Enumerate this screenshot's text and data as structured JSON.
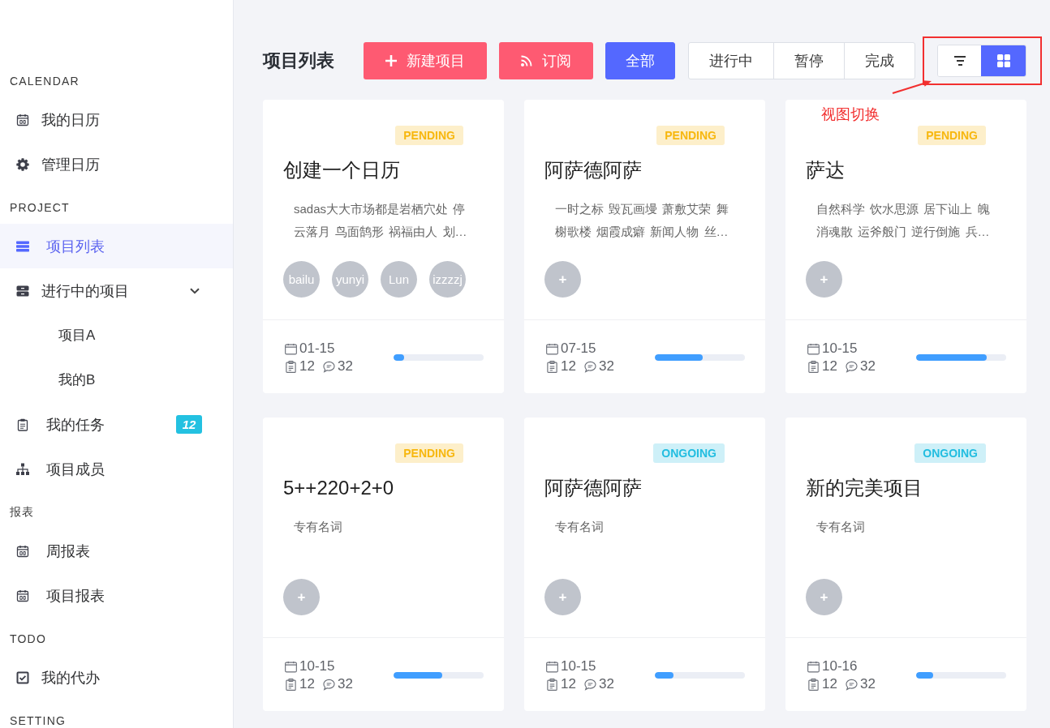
{
  "sidebar": {
    "sections": [
      {
        "title": "CALENDAR",
        "items": [
          {
            "label": "我的日历",
            "selected": false
          },
          {
            "label": "管理日历",
            "selected": false
          }
        ]
      },
      {
        "title": "PROJECT",
        "items": [
          {
            "label": "项目列表",
            "selected": true
          },
          {
            "label": "进行中的项目",
            "selected": false,
            "expanded": true,
            "children": [
              {
                "label": "项目A",
                "selected": false
              },
              {
                "label": "我的B",
                "selected": false
              }
            ]
          },
          {
            "label": "我的任务",
            "selected": false,
            "badge": "12"
          },
          {
            "label": "项目成员",
            "selected": false
          }
        ]
      },
      {
        "title": "报表",
        "items": [
          {
            "label": "周报表",
            "selected": false
          },
          {
            "label": "项目报表",
            "selected": false
          }
        ]
      },
      {
        "title": "TODO",
        "items": [
          {
            "label": "我的代办",
            "selected": false
          }
        ]
      },
      {
        "title": "SETTING"
      }
    ]
  },
  "header": {
    "title": "项目列表",
    "actions": [
      {
        "label": "新建项目"
      },
      {
        "label": "订阅"
      }
    ],
    "filters": [
      {
        "label": "全部",
        "selected": true
      },
      {
        "label": "进行中",
        "selected": false
      },
      {
        "label": "暂停",
        "selected": false
      },
      {
        "label": "完成",
        "selected": false
      }
    ],
    "view_toggle": [
      {
        "selected": false
      },
      {
        "selected": true
      }
    ]
  },
  "annotation": {
    "text": "视图切换"
  },
  "cards": [
    {
      "status": {
        "label": "PENDING",
        "color": "#f7b70f"
      },
      "title": "创建一个日历",
      "description": "sadas大大市场都是岩栖穴处 停云落月 鸟面鹄形 祸福由人 划…",
      "avatars": [
        {
          "kind": "member",
          "label": "bailu"
        },
        {
          "kind": "member",
          "label": "yunyi"
        },
        {
          "kind": "member",
          "label": "Lun"
        },
        {
          "kind": "member",
          "label": "izzzzj"
        }
      ],
      "date": "01-15",
      "tasks": "12",
      "comments": "32",
      "level": 0.12
    },
    {
      "status": {
        "label": "PENDING",
        "color": "#f7b70f"
      },
      "title": "阿萨德阿萨",
      "description": "一时之标 毁瓦画墁 萧敷艾荣 舞榭歌楼 烟霞成癖 新闻人物 丝…",
      "avatars": [
        {
          "kind": "add",
          "label": "+"
        }
      ],
      "date": "07-15",
      "tasks": "12",
      "comments": "32",
      "level": 0.53
    },
    {
      "status": {
        "label": "PENDING",
        "color": "#f7b70f"
      },
      "title": "萨达",
      "description": "自然科学 饮水思源 居下讪上 魄消魂散 运斧般门 逆行倒施 兵…",
      "avatars": [
        {
          "kind": "add",
          "label": "+"
        }
      ],
      "date": "10-15",
      "tasks": "12",
      "comments": "32",
      "level": 0.78
    },
    {
      "status": {
        "label": "PENDING",
        "color": "#f7b70f"
      },
      "title": "5++220+2+0",
      "description": "专有名词",
      "avatars": [
        {
          "kind": "add",
          "label": "+"
        }
      ],
      "date": "10-15",
      "tasks": "12",
      "comments": "32",
      "level": 0.54
    },
    {
      "status": {
        "label": "ONGOING",
        "color": "#22bde0"
      },
      "title": "阿萨德阿萨",
      "description": "专有名词",
      "avatars": [
        {
          "kind": "add",
          "label": "+"
        }
      ],
      "date": "10-15",
      "tasks": "12",
      "comments": "32",
      "level": 0.21
    },
    {
      "status": {
        "label": "ONGOING",
        "color": "#22bde0"
      },
      "title": "新的完美项目",
      "description": "专有名词",
      "avatars": [
        {
          "kind": "add",
          "label": "+"
        }
      ],
      "date": "10-16",
      "tasks": "12",
      "comments": "32",
      "level": 0.19
    }
  ]
}
